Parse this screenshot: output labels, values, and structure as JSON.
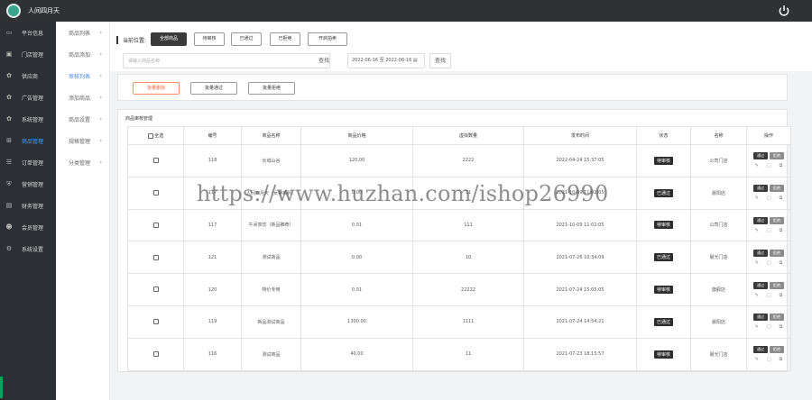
{
  "app": {
    "title": "人间四月天",
    "logo_icon": "logo-icon",
    "power_icon": "power-icon"
  },
  "sidebar": {
    "items": [
      {
        "label": "平台信息",
        "icon": "monitor-icon"
      },
      {
        "label": "门店管理",
        "icon": "store-icon"
      },
      {
        "label": "供应商",
        "icon": "gear-icon"
      },
      {
        "label": "广告管理",
        "icon": "gear-icon"
      },
      {
        "label": "系统管理",
        "icon": "gear-icon"
      },
      {
        "label": "商品管理",
        "icon": "cart-icon",
        "active": true
      },
      {
        "label": "订单管理",
        "icon": "order-icon"
      },
      {
        "label": "营销管理",
        "icon": "shield-icon"
      },
      {
        "label": "财务管理",
        "icon": "chart-icon"
      },
      {
        "label": "会员管理",
        "icon": "user-icon"
      },
      {
        "label": "系统设置",
        "icon": "settings-icon"
      }
    ]
  },
  "subnav": {
    "items": [
      {
        "label": "商品列表",
        "active": false
      },
      {
        "label": "商品添加",
        "active": false
      },
      {
        "label": "审核列表",
        "active": true
      },
      {
        "label": "添加商品",
        "active": false
      },
      {
        "label": "商品设置",
        "active": false
      },
      {
        "label": "规格管理",
        "active": false
      },
      {
        "label": "分类管理",
        "active": false
      }
    ]
  },
  "filter": {
    "location_label": "当前位置:",
    "tabs": [
      {
        "label": "全部商品",
        "active": true
      },
      {
        "label": "待审核",
        "active": false
      },
      {
        "label": "已通过",
        "active": false
      },
      {
        "label": "已拒绝",
        "active": false
      },
      {
        "label": "开启拍卖",
        "active": false
      }
    ],
    "search_placeholder": "请输入商品名称",
    "search_button": "查找",
    "date_range": "2022-06-16 至 2022-06-16 ▤",
    "query_button": "查找"
  },
  "actions": {
    "batch_delete": "批量删除",
    "batch_pass": "批量通过",
    "batch_reject": "批量拒绝"
  },
  "panel": {
    "title": "商品审核管理"
  },
  "table": {
    "headers": [
      "全选",
      "编号",
      "商品名称",
      "商品价格",
      "虚拟数量",
      "发布时间",
      "状态",
      "名称",
      "操作"
    ],
    "rows": [
      {
        "id": "118",
        "name": "长城山谷",
        "price": "120.00",
        "virtual": "2222",
        "time": "2022-04-24 15:37:05",
        "status": "待审核",
        "shop": "公司门店"
      },
      {
        "id": "117",
        "name": "人间四月天（女神系列）",
        "price": "0.00",
        "virtual": "11",
        "time": "2021-10-09 11:02:05",
        "status": "已通过",
        "shop": "晨阳店"
      },
      {
        "id": "117",
        "name": "午间茶饮（新品推荐）",
        "price": "0.01",
        "virtual": "111",
        "time": "2021-10-09 11:02:05",
        "status": "待审核",
        "shop": "公司门店"
      },
      {
        "id": "121",
        "name": "测试商品",
        "price": "0.00",
        "virtual": "10",
        "time": "2021-07-26 10:34:09",
        "status": "已通过",
        "shop": "晨光门店"
      },
      {
        "id": "120",
        "name": "特价专用",
        "price": "0.01",
        "virtual": "22222",
        "time": "2021-07-24 15:05:05",
        "status": "待审核",
        "shop": "旗舰店"
      },
      {
        "id": "119",
        "name": "新品测试商品",
        "price": "1300.00",
        "virtual": "1111",
        "time": "2021-07-24 14:54:21",
        "status": "已通过",
        "shop": "晨阳店"
      },
      {
        "id": "116",
        "name": "测试商品",
        "price": "40.00",
        "virtual": "11",
        "time": "2021-07-23 18:15:57",
        "status": "待审核",
        "shop": "晨光门店"
      }
    ],
    "op_pass": "通过",
    "op_reject": "拒绝",
    "op_icons": [
      "edit-icon",
      "delete-icon",
      "copy-icon"
    ]
  },
  "watermark": "https://www.huzhan.com/ishop26990"
}
